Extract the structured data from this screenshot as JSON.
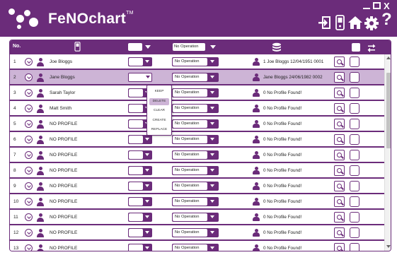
{
  "app": {
    "brand": "FeNOchart",
    "trademark": "TM",
    "accent_color": "#6b2c7a",
    "selected_row_color": "#cdb4d6"
  },
  "window_controls": {
    "minimize_icon": "minimize-icon",
    "maximize_icon": "maximize-icon",
    "close_label": "X"
  },
  "toolbar": {
    "help_label": "?",
    "icons": [
      "logout-icon",
      "device-icon",
      "home-icon",
      "settings-icon"
    ]
  },
  "table": {
    "headers": {
      "no": "No.",
      "device_icon": "device-icon",
      "operation": "No Operation",
      "database_icon": "database-icon",
      "transfer_icon": "transfer-icon"
    },
    "rows": [
      {
        "no": "1",
        "name": "Joe Bloggs",
        "operation": "No Operation",
        "profile": "1 Joe Bloggs 12/04/1951 0001",
        "selected": false
      },
      {
        "no": "2",
        "name": "Jane Bloggs",
        "operation": "No Operation",
        "profile": "Jane Bloggs 24/06/1982 0002",
        "selected": true
      },
      {
        "no": "3",
        "name": "Sarah Taylor",
        "operation": "No Operation",
        "profile": "0 No Profile Found!",
        "selected": false
      },
      {
        "no": "4",
        "name": "Matt Smith",
        "operation": "No Operation",
        "profile": "0 No Profile Found!",
        "selected": false
      },
      {
        "no": "5",
        "name": "NO PROFILE",
        "operation": "No Operation",
        "profile": "0 No Profile Found!",
        "selected": false
      },
      {
        "no": "6",
        "name": "NO PROFILE",
        "operation": "No Operation",
        "profile": "0 No Profile Found!",
        "selected": false
      },
      {
        "no": "7",
        "name": "NO PROFILE",
        "operation": "No Operation",
        "profile": "0 No Profile Found!",
        "selected": false
      },
      {
        "no": "8",
        "name": "NO PROFILE",
        "operation": "No Operation",
        "profile": "0 No Profile Found!",
        "selected": false
      },
      {
        "no": "9",
        "name": "NO PROFILE",
        "operation": "No Operation",
        "profile": "0 No Profile Found!",
        "selected": false
      },
      {
        "no": "10",
        "name": "NO PROFILE",
        "operation": "No Operation",
        "profile": "0 No Profile Found!",
        "selected": false
      },
      {
        "no": "11",
        "name": "NO PROFILE",
        "operation": "No Operation",
        "profile": "0 No Profile Found!",
        "selected": false
      },
      {
        "no": "12",
        "name": "NO PROFILE",
        "operation": "No Operation",
        "profile": "0 No Profile Found!",
        "selected": false
      },
      {
        "no": "13",
        "name": "NO PROFILE",
        "operation": "No Operation",
        "profile": "0 No Profile Found!",
        "selected": false
      }
    ]
  },
  "dropdown": {
    "items": [
      "KEEP",
      "DELETE",
      "CLEAR",
      "CREATE",
      "REPLACE"
    ],
    "highlighted": "DELETE"
  }
}
